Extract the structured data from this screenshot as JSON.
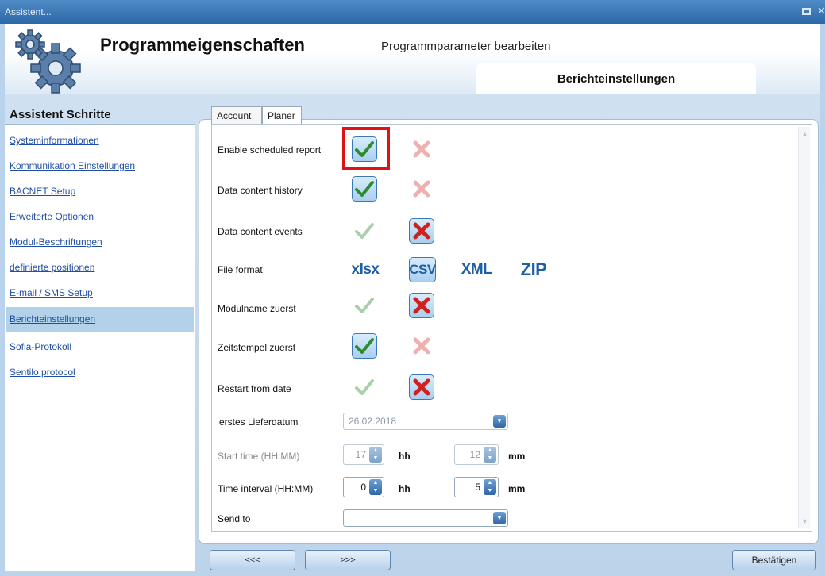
{
  "window": {
    "title": "Assistent..."
  },
  "header": {
    "title": "Programmeigenschaften",
    "subtitle": "Programmparameter bearbeiten",
    "section_tab": "Berichteinstellungen"
  },
  "sidebar": {
    "title": "Assistent Schritte",
    "items": [
      {
        "label": "Systeminformationen"
      },
      {
        "label": "Kommunikation Einstellungen"
      },
      {
        "label": "BACNET Setup"
      },
      {
        "label": "Erweiterte Optionen"
      },
      {
        "label": "Modul-Beschriftungen"
      },
      {
        "label": "definierte positionen"
      },
      {
        "label": "E-mail / SMS Setup"
      },
      {
        "label": "Berichteinstellungen"
      },
      {
        "label": "Sofia-Protokoll"
      },
      {
        "label": "Sentilo protocol"
      }
    ],
    "selected": "Berichteinstellungen"
  },
  "tabs": [
    {
      "label": "Account"
    },
    {
      "label": "Planer"
    }
  ],
  "active_tab": "Planer",
  "options": [
    {
      "label": "Enable scheduled report",
      "value": "yes"
    },
    {
      "label": "Data content history",
      "value": "yes"
    },
    {
      "label": "Data content events",
      "value": "no"
    },
    {
      "label": "Modulname zuerst",
      "value": "no"
    },
    {
      "label": "Zeitstempel zuerst",
      "value": "yes"
    },
    {
      "label": "Restart from date",
      "value": "no"
    }
  ],
  "file_format": {
    "label": "File format",
    "choices": [
      "xlsx",
      "CSV",
      "XML",
      "ZIP"
    ],
    "selected": "CSV"
  },
  "first_delivery": {
    "label": "erstes Lieferdatum",
    "value": "26.02.2018"
  },
  "start_time": {
    "label": "Start time (HH:MM)",
    "hh": "17",
    "mm": "12",
    "hh_unit": "hh",
    "mm_unit": "mm"
  },
  "time_interval": {
    "label": "Time interval (HH:MM)",
    "hh": "0",
    "mm": "5",
    "hh_unit": "hh",
    "mm_unit": "mm"
  },
  "send_to": {
    "label": "Send to",
    "value": ""
  },
  "nav": {
    "prev": "<<<",
    "next": ">>>",
    "confirm": "Bestätigen"
  },
  "colors": {
    "accent": "#2d68a8",
    "highlight": "#e01313",
    "link": "#1f4fa5",
    "selected_step": "#b3d2ea"
  }
}
